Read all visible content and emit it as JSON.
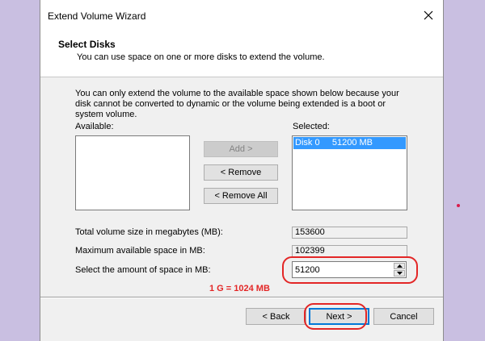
{
  "window": {
    "title": "Extend Volume Wizard"
  },
  "header": {
    "title": "Select Disks",
    "subtitle": "You can use space on one or more disks to extend the volume."
  },
  "info_text": "You can only extend the volume to the available space shown below because your disk cannot be converted to dynamic or the volume being extended is a boot or system volume.",
  "available": {
    "label": "Available:",
    "items": []
  },
  "selected": {
    "label": "Selected:",
    "items": [
      {
        "disk": "Disk 0",
        "size": "51200 MB"
      }
    ]
  },
  "buttons": {
    "add": "Add >",
    "remove": "< Remove",
    "remove_all": "< Remove All",
    "back": "< Back",
    "next": "Next >",
    "cancel": "Cancel"
  },
  "fields": {
    "total_label": "Total volume size in megabytes (MB):",
    "total_value": "153600",
    "max_label": "Maximum available space in MB:",
    "max_value": "102399",
    "amount_label": "Select the amount of space in MB:",
    "amount_value": "51200"
  },
  "annotation": {
    "text": "1 G = 1024 MB",
    "color": "#e32626"
  },
  "icons": {
    "close": "close-icon",
    "spin_up": "spin-up-icon",
    "spin_down": "spin-down-icon"
  }
}
